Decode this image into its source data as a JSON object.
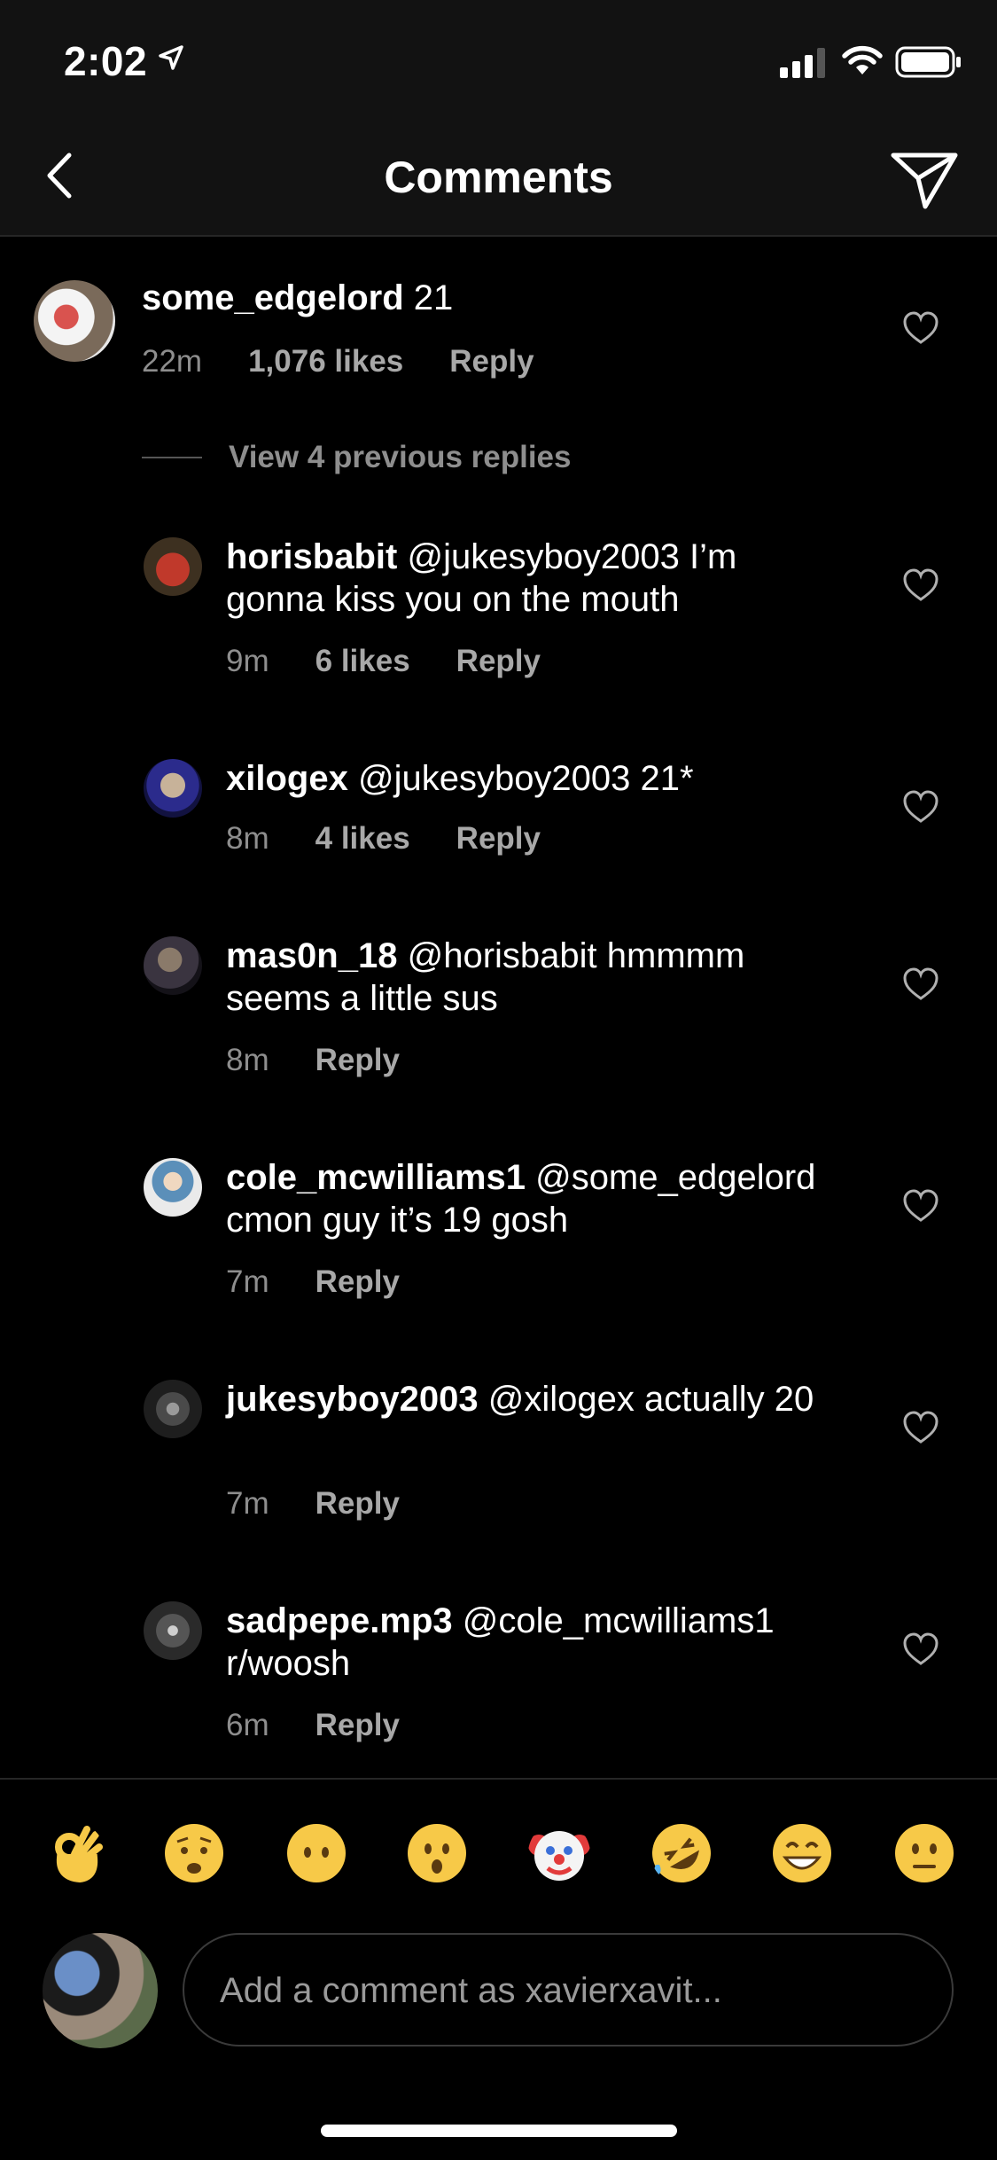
{
  "status_bar": {
    "time": "2:02"
  },
  "header": {
    "title": "Comments"
  },
  "main_comment": {
    "username": "some_edgelord",
    "text": " 21",
    "time": "22m",
    "likes": "1,076 likes",
    "reply": "Reply"
  },
  "view_previous": "View 4 previous replies",
  "replies": [
    {
      "username": "horisbabit",
      "text": " @jukesyboy2003 I’m gonna kiss you on the mouth",
      "time": "9m",
      "likes": "6 likes",
      "reply": "Reply"
    },
    {
      "username": "xilogex",
      "text": " @jukesyboy2003 21*",
      "time": "8m",
      "likes": "4 likes",
      "reply": "Reply"
    },
    {
      "username": "mas0n_18",
      "text": " @horisbabit hmmmm seems a little sus",
      "time": "8m",
      "reply": "Reply"
    },
    {
      "username": "cole_mcwilliams1",
      "text": " @some_edgelord cmon guy it’s 19 gosh",
      "time": "7m",
      "reply": "Reply"
    },
    {
      "username": "jukesyboy2003",
      "text": " @xilogex actually 20",
      "time": "7m",
      "reply": "Reply"
    },
    {
      "username": "sadpepe.mp3",
      "text": " @cole_mcwilliams1 r/woosh",
      "time": "6m",
      "reply": "Reply"
    }
  ],
  "emoji_bar": [
    "ok-hand-emoji",
    "anxious-face-emoji",
    "no-mouth-face-emoji",
    "hushed-face-emoji",
    "clown-face-emoji",
    "rofl-emoji",
    "grin-emoji",
    "neutral-face-emoji"
  ],
  "composer": {
    "placeholder": "Add a comment as xavierxavit..."
  },
  "colors": {
    "background": "#000000",
    "bar": "#121212",
    "muted_text": "#8e8e8e",
    "emoji_yellow": "#f7c948"
  }
}
